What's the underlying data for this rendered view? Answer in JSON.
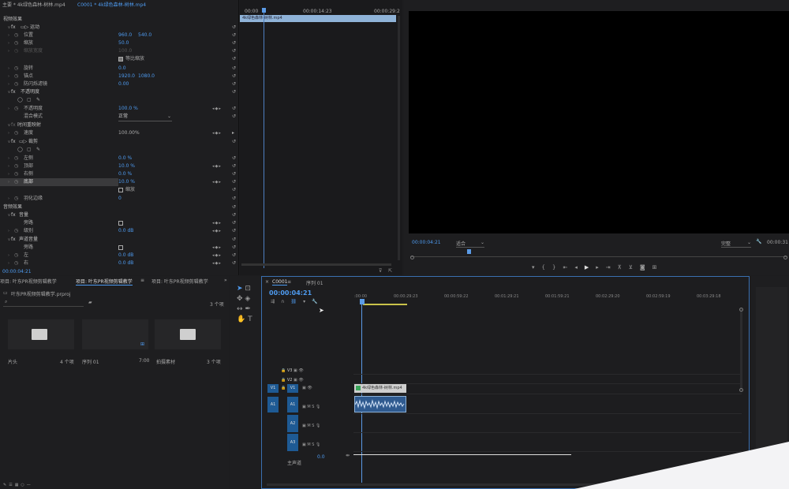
{
  "effect_controls": {
    "tab_master": "主要 * 4k绿色森林-树林.mp4",
    "tab_sequence": "C0001 * 4k绿色森林-树林.mp4",
    "video_effects": "视频效果",
    "motion": "运动",
    "position": "位置",
    "position_x": "960.0",
    "position_y": "540.0",
    "scale": "缩放",
    "scale_val": "50.0",
    "scale_width": "缩放宽度",
    "scale_width_val": "100.0",
    "uniform_scale": "等比缩放",
    "rotation": "旋转",
    "rotation_val": "0.0",
    "anchor": "锚点",
    "anchor_x": "1920.0",
    "anchor_y": "1080.0",
    "anti_flicker": "防闪烁滤镜",
    "anti_flicker_val": "0.00",
    "opacity": "不透明度",
    "opacity_prop": "不透明度",
    "opacity_val": "100.0 %",
    "blend_mode": "混合模式",
    "blend_mode_val": "正常",
    "time_remap": "时间重映射",
    "speed": "速度",
    "speed_val": "100.00%",
    "crop": "裁剪",
    "left": "左侧",
    "left_val": "0.0 %",
    "top": "顶部",
    "top_val": "10.0 %",
    "right": "右侧",
    "right_val": "0.0 %",
    "bottom": "底部",
    "bottom_val": "10.0 %",
    "zoom": "缩放",
    "feather": "羽化边缘",
    "feather_val": "0",
    "audio_effects": "音频效果",
    "volume": "音量",
    "bypass": "旁路",
    "level": "级别",
    "level_val": "0.0 dB",
    "channel_volume": "声道音量",
    "bypass2": "旁路",
    "l": "左",
    "l_val": "0.0 dB",
    "r": "右",
    "r_val": "0.0 dB",
    "timecode": "00:00:04:21"
  },
  "mini_timeline": {
    "t0": "00:00",
    "t1": "00:00:14:23",
    "t2": "00:00:29:2",
    "clip": "4k绿色森林-树林.mp4"
  },
  "program": {
    "timecode": "00:00:04:21",
    "fit": "适合",
    "quality": "完整",
    "end_time": "00:00:31"
  },
  "project": {
    "tab1": "项目: 叶东PR视频剪辑教学",
    "tab2": "项目: 叶东PR视频剪辑教学",
    "tab3": "项目: 叶东PR视频剪辑教学",
    "file": "叶东PR视频剪辑教学.prproj",
    "count": "3 个项",
    "bins": [
      {
        "name": "片头",
        "info": "4 个项"
      },
      {
        "name": "序列 01",
        "info": "7:00"
      },
      {
        "name": "拍摄素材",
        "info": "3 个项"
      }
    ]
  },
  "timeline": {
    "tab_seq": "C0001",
    "tab_seq2": "序列 01",
    "timecode": "00:00:04:21",
    "ruler": [
      ":00:00",
      "00:00:29:23",
      "00:00:59:22",
      "00:01:29:21",
      "00:01:59:21",
      "00:02:29:20",
      "00:02:59:19",
      "00:03:29:18"
    ],
    "tracks_v": [
      "V3",
      "V2",
      "V1"
    ],
    "tracks_a": [
      "A1",
      "A2",
      "A3"
    ],
    "src_v": "V1",
    "src_a": "A1",
    "clip_label": "4k绿色森林-树林.mp4",
    "master": "主声道",
    "master_val": "0.0"
  }
}
